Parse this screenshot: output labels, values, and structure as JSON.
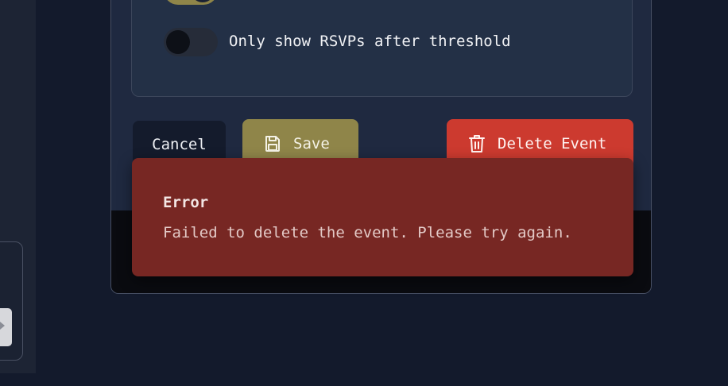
{
  "settings": {
    "rsvp_toggle_label": "Only show RSVPs after threshold",
    "rsvp_toggle_on": false,
    "top_toggle_on": true
  },
  "actions": {
    "cancel_label": "Cancel",
    "save_label": "Save",
    "delete_label": "Delete Event"
  },
  "toast": {
    "title": "Error",
    "message": "Failed to delete the event. Please try again."
  },
  "icons": {
    "save": "floppy-disk-icon",
    "delete": "trash-icon"
  },
  "colors": {
    "accent": "#8f8549",
    "danger": "#cc3a2f",
    "error_toast": "#772723",
    "background": "#131a2c"
  }
}
